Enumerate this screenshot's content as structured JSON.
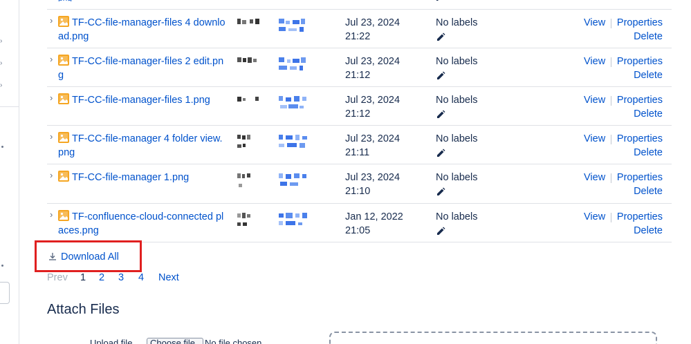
{
  "attachments": {
    "previous_row_tail": "png",
    "rows": [
      {
        "name": "TF-CC-file-manager-files 4 download.png",
        "date": "Jul 23, 2024",
        "time": "21:22",
        "labels": "No labels",
        "view": "View",
        "properties": "Properties",
        "delete": "Delete"
      },
      {
        "name": "TF-CC-file-manager-files 2 edit.png",
        "date": "Jul 23, 2024",
        "time": "21:12",
        "labels": "No labels",
        "view": "View",
        "properties": "Properties",
        "delete": "Delete"
      },
      {
        "name": "TF-CC-file-manager-files 1.png",
        "date": "Jul 23, 2024",
        "time": "21:12",
        "labels": "No labels",
        "view": "View",
        "properties": "Properties",
        "delete": "Delete"
      },
      {
        "name": "TF-CC-file-manager 4 folder view.png",
        "date": "Jul 23, 2024",
        "time": "21:11",
        "labels": "No labels",
        "view": "View",
        "properties": "Properties",
        "delete": "Delete"
      },
      {
        "name": "TF-CC-file-manager 1.png",
        "date": "Jul 23, 2024",
        "time": "21:10",
        "labels": "No labels",
        "view": "View",
        "properties": "Properties",
        "delete": "Delete"
      },
      {
        "name": "TF-confluence-cloud-connected places.png",
        "date": "Jan 12, 2022",
        "time": "21:05",
        "labels": "No labels",
        "view": "View",
        "properties": "Properties",
        "delete": "Delete"
      }
    ]
  },
  "download_all": {
    "label": "Download All",
    "icon": "download-icon"
  },
  "pagination": {
    "prev": "Prev",
    "current": "1",
    "pages": [
      "2",
      "3",
      "4"
    ],
    "next": "Next"
  },
  "attach": {
    "title": "Attach Files",
    "upload_label": "Upload file",
    "choose_button": "Choose file",
    "no_file": "No file chosen"
  },
  "colors": {
    "link": "#0052cc",
    "text": "#172b4d",
    "highlight_box": "#e02020",
    "file_icon": "#f5a623",
    "muted": "#a5adba"
  },
  "icons": {
    "file": "image-file-icon",
    "expand": "chevron-right-icon",
    "edit_labels": "pencil-icon"
  }
}
